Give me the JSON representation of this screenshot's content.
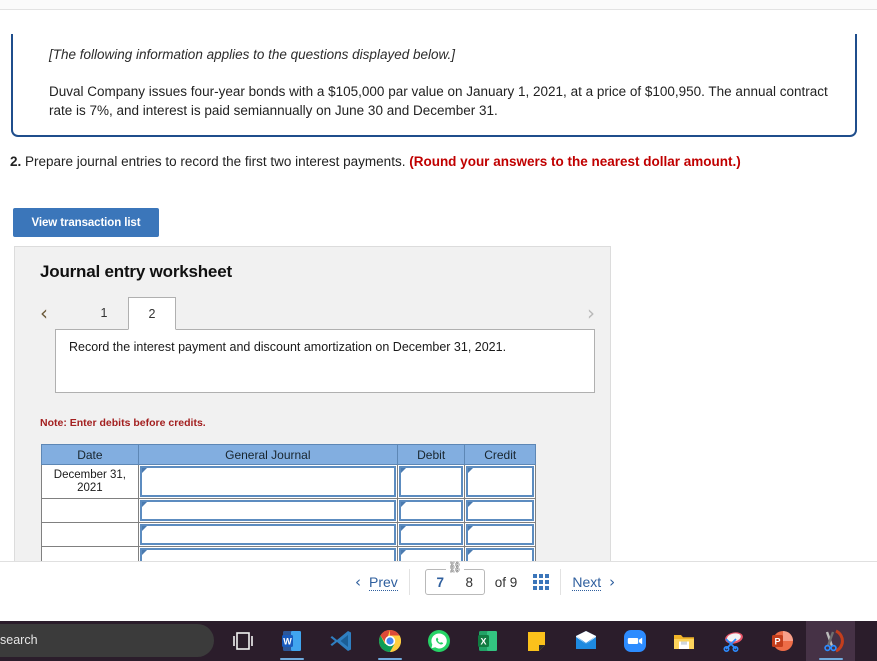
{
  "info_box": {
    "italic_note": "[The following information applies to the questions displayed below.]",
    "body": "Duval Company issues four-year bonds with a $105,000 par value on January 1, 2021, at a price of $100,950. The annual contract rate is 7%, and interest is paid semiannually on June 30 and December 31."
  },
  "question": {
    "number": "2.",
    "text": " Prepare journal entries to record the first two interest payments. ",
    "warning": "(Round your answers to the nearest dollar amount.)"
  },
  "buttons": {
    "view_transaction_list": "View transaction list"
  },
  "worksheet": {
    "title": "Journal entry worksheet",
    "prev_arrow": "‹",
    "next_arrow": "›",
    "tabs": [
      {
        "label": "1",
        "active": false
      },
      {
        "label": "2",
        "active": true
      }
    ],
    "instruction": "Record the interest payment and discount amortization on December 31, 2021.",
    "note": "Note: Enter debits before credits.",
    "table": {
      "headers": [
        "Date",
        "General Journal",
        "Debit",
        "Credit"
      ],
      "rows": [
        {
          "date": "December 31, 2021",
          "general_journal": "",
          "debit": "",
          "credit": ""
        },
        {
          "date": "",
          "general_journal": "",
          "debit": "",
          "credit": ""
        },
        {
          "date": "",
          "general_journal": "",
          "debit": "",
          "credit": ""
        },
        {
          "date": "",
          "general_journal": "",
          "debit": "",
          "credit": ""
        },
        {
          "date": "",
          "general_journal": "",
          "debit": "",
          "credit": ""
        }
      ]
    }
  },
  "footer": {
    "prev_label": "Prev",
    "prev_chevron": "‹",
    "current_page": "7",
    "next_page": "8",
    "chain_icon": "⛓",
    "of_label": "of 9",
    "grid_icon": "grid-icon",
    "next_label": "Next",
    "next_chevron": "›"
  },
  "taskbar": {
    "search_text": "search",
    "items": [
      {
        "name": "task-view-icon",
        "label": "Task View"
      },
      {
        "name": "word-icon",
        "label": "Microsoft Word"
      },
      {
        "name": "vscode-icon",
        "label": "Visual Studio Code"
      },
      {
        "name": "chrome-icon",
        "label": "Google Chrome"
      },
      {
        "name": "whatsapp-icon",
        "label": "WhatsApp"
      },
      {
        "name": "excel-icon",
        "label": "Microsoft Excel"
      },
      {
        "name": "sticky-notes-icon",
        "label": "Sticky Notes"
      },
      {
        "name": "mail-icon",
        "label": "Mail"
      },
      {
        "name": "zoom-icon",
        "label": "Zoom"
      },
      {
        "name": "file-explorer-icon",
        "label": "File Explorer"
      },
      {
        "name": "snipping-tool-icon",
        "label": "Snip & Sketch"
      },
      {
        "name": "powerpoint-icon",
        "label": "Microsoft PowerPoint"
      },
      {
        "name": "snipping-tool-active-icon",
        "label": "Snipping Tool"
      }
    ]
  },
  "colors": {
    "accent_blue": "#3b76ba",
    "box_border": "#1f4e8c",
    "warning_red": "#c00000",
    "table_header": "#82aee0",
    "note_red": "#a32020",
    "taskbar_bg": "#2b1d2b"
  }
}
